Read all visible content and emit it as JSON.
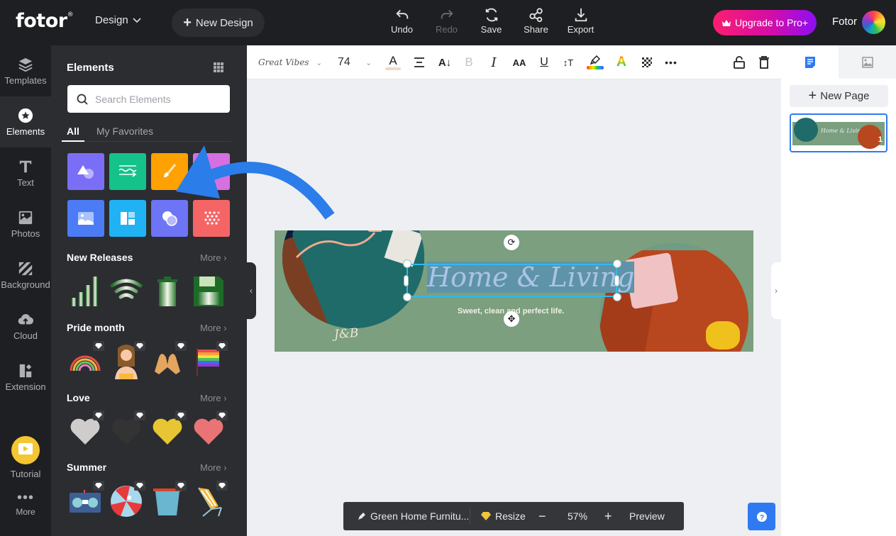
{
  "app": {
    "logo": "fotor",
    "logo_mark": "®",
    "design_menu": "Design",
    "new_design": "New Design",
    "user_name": "Fotor",
    "upgrade": "Upgrade to Pro+"
  },
  "top_actions": [
    {
      "label": "Undo",
      "icon": "undo-icon",
      "enabled": true
    },
    {
      "label": "Redo",
      "icon": "redo-icon",
      "enabled": false
    },
    {
      "label": "Save",
      "icon": "save-icon",
      "enabled": true
    },
    {
      "label": "Share",
      "icon": "share-icon",
      "enabled": true
    },
    {
      "label": "Export",
      "icon": "export-icon",
      "enabled": true
    }
  ],
  "left_nav": [
    {
      "label": "Templates",
      "icon": "layers-icon",
      "active": false
    },
    {
      "label": "Elements",
      "icon": "star-icon",
      "active": true
    },
    {
      "label": "Text",
      "icon": "text-icon",
      "active": false
    },
    {
      "label": "Photos",
      "icon": "photo-icon",
      "active": false
    },
    {
      "label": "Background",
      "icon": "background-icon",
      "active": false
    },
    {
      "label": "Cloud",
      "icon": "cloud-upload-icon",
      "active": false
    },
    {
      "label": "Extension",
      "icon": "extension-icon",
      "active": false
    },
    {
      "label": "Tutorial",
      "icon": "play-icon",
      "active": false
    },
    {
      "label": "More",
      "icon": "more-icon",
      "active": false
    }
  ],
  "elements_panel": {
    "title": "Elements",
    "search_placeholder": "Search Elements",
    "tabs": [
      {
        "label": "All",
        "active": true
      },
      {
        "label": "My Favorites",
        "active": false
      }
    ],
    "categories": [
      {
        "name": "shapes",
        "color": "#7b6ef6"
      },
      {
        "name": "lines",
        "color": "#14c28a"
      },
      {
        "name": "illustrations",
        "color": "#ffa100"
      },
      {
        "name": "stickers",
        "color": "#d66fe0"
      },
      {
        "name": "photos",
        "color": "#4b7cf6"
      },
      {
        "name": "frames",
        "color": "#1fb3f5"
      },
      {
        "name": "masks",
        "color": "#6e74f6"
      },
      {
        "name": "patterns",
        "color": "#f56566"
      }
    ],
    "sections": [
      {
        "title": "New Releases",
        "more": "More",
        "items": [
          "signal-bars",
          "wifi",
          "trash-can",
          "floppy-disk"
        ],
        "premium": false
      },
      {
        "title": "Pride month",
        "more": "More",
        "items": [
          "rainbow",
          "woman",
          "heart-hands",
          "pride-flag"
        ],
        "premium": true
      },
      {
        "title": "Love",
        "more": "More",
        "items": [
          "white-heart",
          "black-heart",
          "yellow-heart",
          "pink-heart"
        ],
        "premium": true
      },
      {
        "title": "Summer",
        "more": "More",
        "items": [
          "boombox",
          "beach-ball",
          "bucket",
          "beach-chair"
        ],
        "premium": true
      }
    ]
  },
  "toolbar": {
    "font_name": "Great Vibes",
    "font_size": "74",
    "text_color": "#e9d6c4"
  },
  "canvas": {
    "monogram": "J&B",
    "headline": "Home & Living",
    "tagline": "Sweet, clean and perfect life.",
    "background_color": "#7b9f7f"
  },
  "right_panel": {
    "new_page": "New Page",
    "page_number": "1"
  },
  "bottom_bar": {
    "file_name": "Green Home Furnitu...",
    "resize": "Resize",
    "zoom": "57%",
    "preview": "Preview"
  }
}
